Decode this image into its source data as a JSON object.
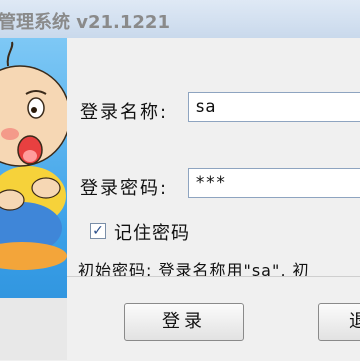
{
  "window": {
    "title": "管理系统 v21.1221"
  },
  "form": {
    "username_label": "登录名称:",
    "username_value": "sa",
    "password_label": "登录密码:",
    "password_value": "***",
    "remember_label": "记住密码",
    "remember_checked": true,
    "hint": "初始密码: 登录名称用\"sa\", 初"
  },
  "buttons": {
    "login": "登录",
    "cancel": "退"
  }
}
